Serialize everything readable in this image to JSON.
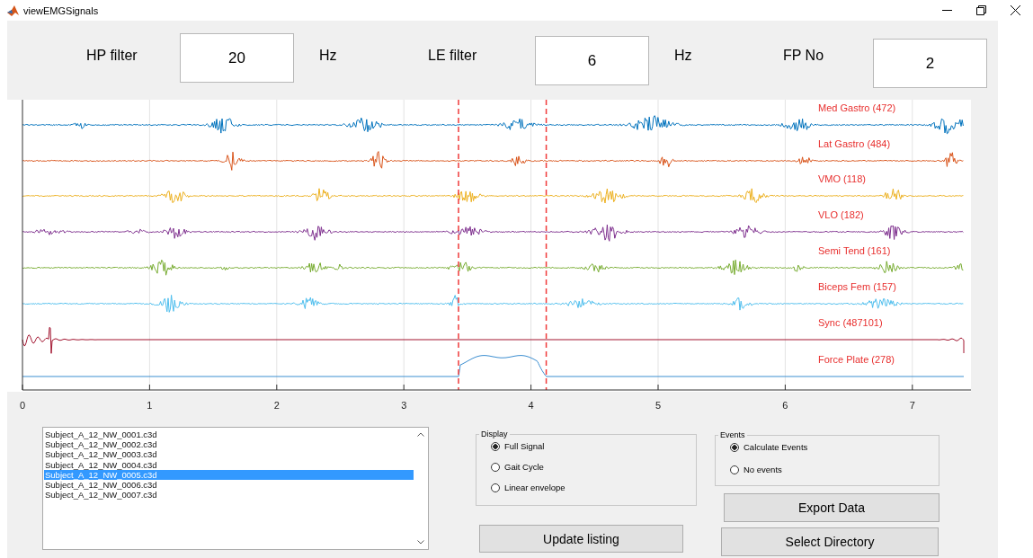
{
  "window": {
    "title": "viewEMGSignals"
  },
  "filters": [
    {
      "label": "HP filter",
      "value": "20",
      "unit": "Hz"
    },
    {
      "label": "LE filter",
      "value": "6",
      "unit": "Hz"
    },
    {
      "label": "FP No",
      "value": "2"
    }
  ],
  "plot": {
    "traces": [
      {
        "name": "Med Gastro (472)",
        "color": "#0072bd",
        "kind": "emg"
      },
      {
        "name": "Lat Gastro (484)",
        "color": "#d95319",
        "kind": "emg"
      },
      {
        "name": "VMO (118)",
        "color": "#edb120",
        "kind": "emg"
      },
      {
        "name": "VLO (182)",
        "color": "#7e2f8e",
        "kind": "emg"
      },
      {
        "name": "Semi Tend (161)",
        "color": "#77ac30",
        "kind": "emg"
      },
      {
        "name": "Biceps Fem (157)",
        "color": "#4dbeee",
        "kind": "emg"
      },
      {
        "name": "Sync (487101)",
        "color": "#a2142f",
        "kind": "sync"
      },
      {
        "name": "Force Plate (278)",
        "color": "#3d8fd1",
        "kind": "force"
      }
    ],
    "x_ticks": [
      "0",
      "1",
      "2",
      "3",
      "4",
      "5",
      "6",
      "7"
    ]
  },
  "files": [
    {
      "label": "Subject_A_12_NW_0001.c3d",
      "selected": false
    },
    {
      "label": "Subject_A_12_NW_0002.c3d",
      "selected": false
    },
    {
      "label": "Subject_A_12_NW_0003.c3d",
      "selected": false
    },
    {
      "label": "Subject_A_12_NW_0004.c3d",
      "selected": false
    },
    {
      "label": "Subject_A_12_NW_0005.c3d",
      "selected": true
    },
    {
      "label": "Subject_A_12_NW_0006.c3d",
      "selected": false
    },
    {
      "label": "Subject_A_12_NW_0007.c3d",
      "selected": false
    }
  ],
  "display": {
    "title": "Display",
    "options": [
      {
        "label": "Full Signal",
        "selected": true
      },
      {
        "label": "Gait Cycle",
        "selected": false
      },
      {
        "label": "Linear envelope",
        "selected": false
      }
    ]
  },
  "update_button": "Update listing",
  "events": {
    "title": "Events",
    "options": [
      {
        "label": "Calculate Events",
        "selected": true
      },
      {
        "label": "No events",
        "selected": false
      }
    ]
  },
  "buttons": [
    "Export Data",
    "Select Directory"
  ]
}
